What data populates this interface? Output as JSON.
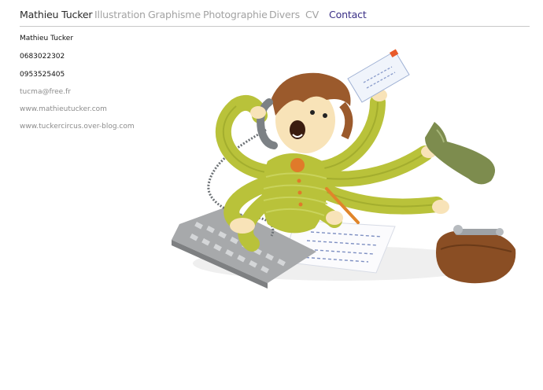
{
  "nav": {
    "brand": "Mathieu Tucker",
    "items": [
      "Illustration",
      "Graphisme",
      "Photographie",
      "Divers",
      "CV",
      "Contact"
    ],
    "active": "Contact"
  },
  "contact": {
    "name": "Mathieu Tucker",
    "phone1": "0683022302",
    "phone2": "0953525405",
    "email": "tucma@free.fr",
    "website1": "www.mathieutucker.com",
    "website2": "www.tuckercircus.over-blog.com"
  },
  "colors": {
    "active_nav": "#3a2f86",
    "inactive_nav": "#a3a3a3",
    "brand": "#2b2b2b",
    "link": "#8c8c8c",
    "sweater": "#b9c23a"
  }
}
